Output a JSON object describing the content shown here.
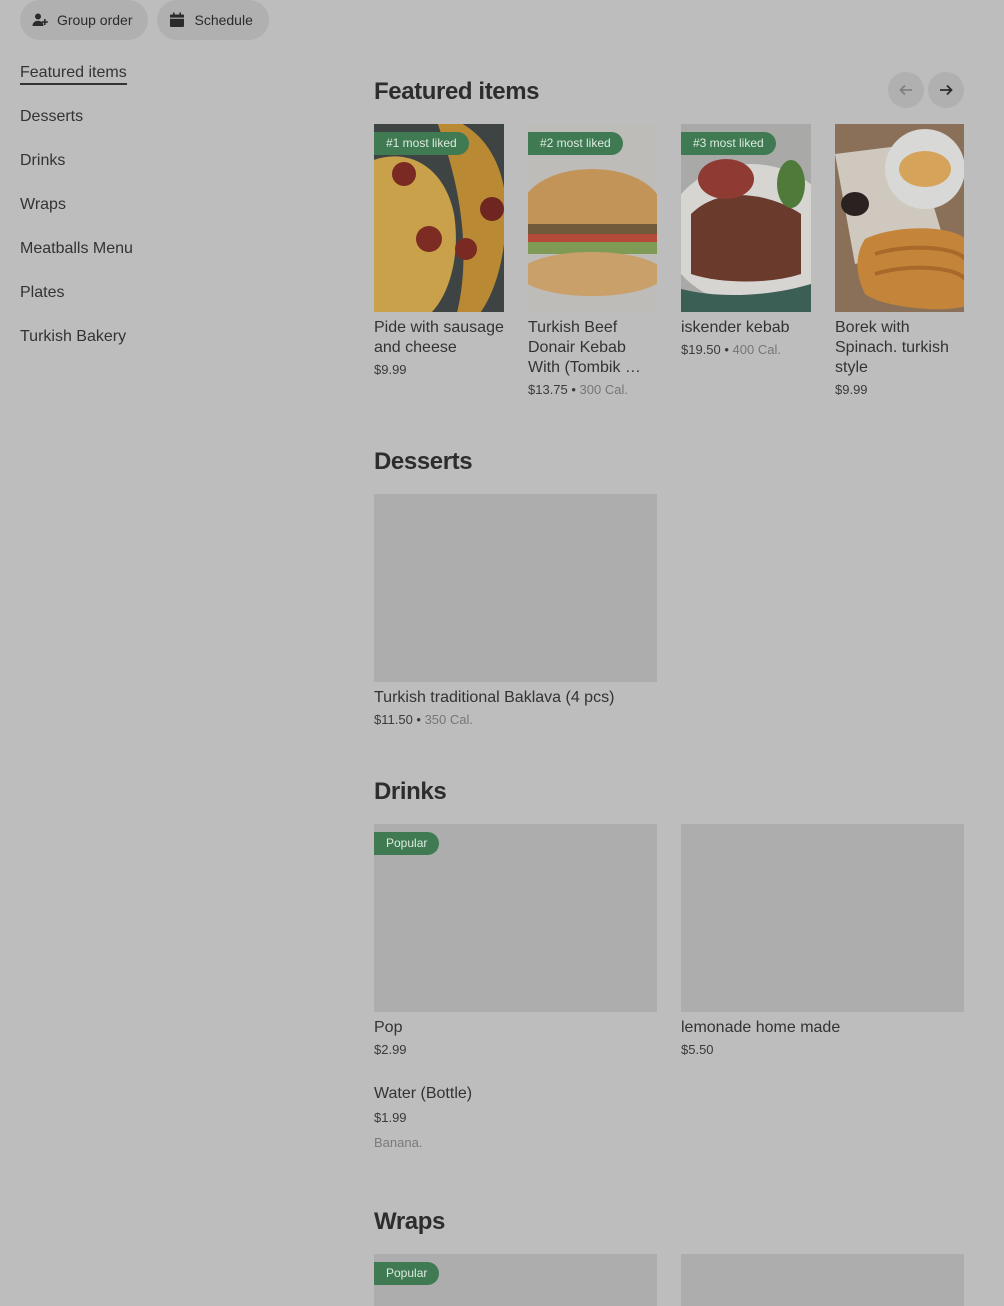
{
  "header": {
    "group_order_label": "Group order",
    "schedule_label": "Schedule"
  },
  "sidebar": {
    "items": [
      {
        "label": "Featured items",
        "active": true
      },
      {
        "label": "Desserts"
      },
      {
        "label": "Drinks"
      },
      {
        "label": "Wraps"
      },
      {
        "label": "Meatballs Menu"
      },
      {
        "label": "Plates"
      },
      {
        "label": "Turkish Bakery"
      }
    ]
  },
  "icons": {
    "group_order": "person-add-icon",
    "schedule": "calendar-icon",
    "prev": "arrow-left-icon",
    "next": "arrow-right-icon"
  },
  "colors": {
    "badge_bg": "#3f7a52",
    "page_bg": "#bdbdbd"
  },
  "sections": {
    "featured": {
      "title": "Featured items",
      "items": [
        {
          "badge": "#1 most liked",
          "name": "Pide with sausage and cheese",
          "price": "$9.99",
          "cal": ""
        },
        {
          "badge": "#2 most liked",
          "name": "Turkish Beef Donair Kebab With (Tombik …",
          "price": "$13.75",
          "cal": "300 Cal."
        },
        {
          "badge": "#3 most liked",
          "name": "iskender kebab",
          "price": "$19.50",
          "cal": "400 Cal."
        },
        {
          "badge": "",
          "name": "Borek with Spinach. turkish style",
          "price": "$9.99",
          "cal": ""
        }
      ]
    },
    "desserts": {
      "title": "Desserts",
      "items": [
        {
          "name": "Turkish traditional Baklava (4 pcs)",
          "price": "$11.50",
          "cal": "350 Cal."
        }
      ]
    },
    "drinks": {
      "title": "Drinks",
      "items": [
        {
          "badge": "Popular",
          "name": "Pop",
          "price": "$2.99"
        },
        {
          "name": "lemonade home made",
          "price": "$5.50"
        },
        {
          "name": "Water (Bottle)",
          "price": "$1.99",
          "description": "Banana."
        }
      ]
    },
    "wraps": {
      "title": "Wraps",
      "items": [
        {
          "badge": "Popular"
        },
        {}
      ]
    }
  }
}
